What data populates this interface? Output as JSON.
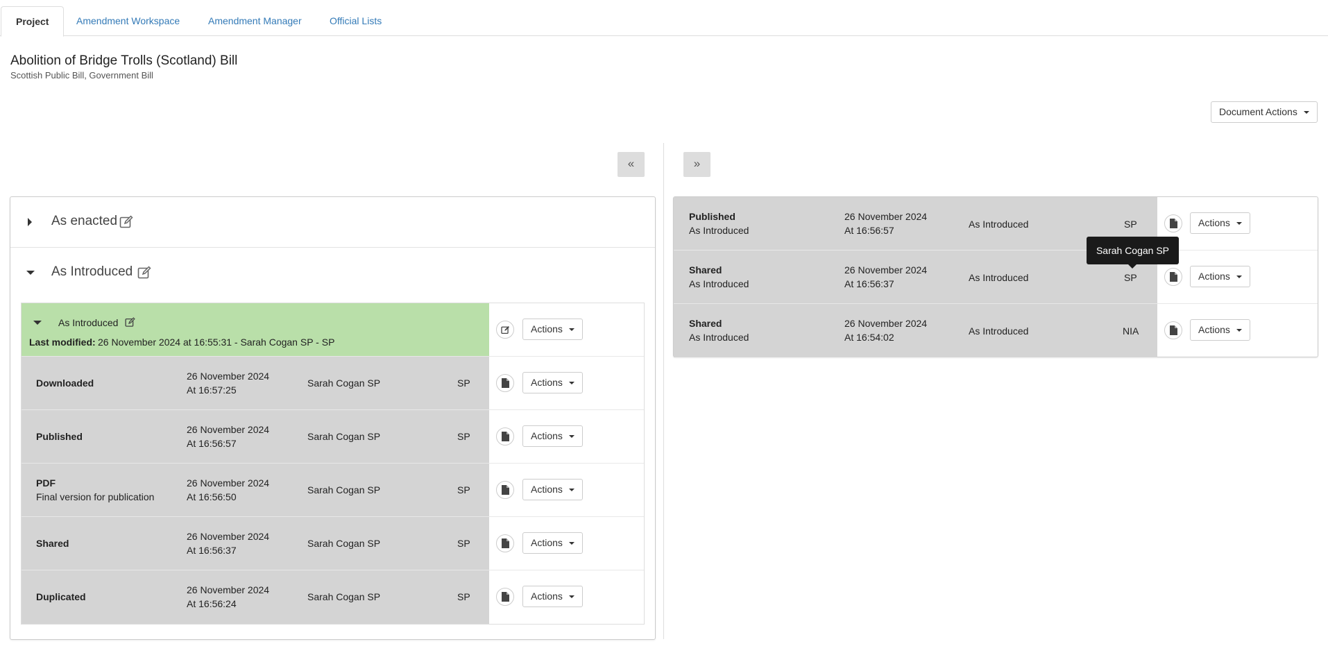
{
  "tabs": [
    {
      "label": "Project"
    },
    {
      "label": "Amendment Workspace"
    },
    {
      "label": "Amendment Manager"
    },
    {
      "label": "Official Lists"
    }
  ],
  "project": {
    "title": "Abolition of Bridge Trolls (Scotland) Bill",
    "subtitle": "Scottish Public Bill, Government Bill"
  },
  "document_actions_label": "Document Actions",
  "collapse_left_label": "«",
  "expand_right_label": "»",
  "left": {
    "sections": [
      {
        "label": "As enacted",
        "expanded": false
      },
      {
        "label": "As Introduced",
        "expanded": true
      }
    ],
    "version": {
      "label": "As Introduced",
      "last_modified_label": "Last modified:",
      "last_modified_value": "26 November 2024 at 16:55:31 - Sarah Cogan SP - SP",
      "actions_label": "Actions"
    },
    "rows": [
      {
        "event": "Downloaded",
        "note": "",
        "date": "26 November 2024",
        "time": "At 16:57:25",
        "user": "Sarah Cogan SP",
        "org": "SP",
        "actions_label": "Actions"
      },
      {
        "event": "Published",
        "note": "",
        "date": "26 November 2024",
        "time": "At 16:56:57",
        "user": "Sarah Cogan SP",
        "org": "SP",
        "actions_label": "Actions"
      },
      {
        "event": "PDF",
        "note": "Final version for publication",
        "date": "26 November 2024",
        "time": "At 16:56:50",
        "user": "Sarah Cogan SP",
        "org": "SP",
        "actions_label": "Actions"
      },
      {
        "event": "Shared",
        "note": "",
        "date": "26 November 2024",
        "time": "At 16:56:37",
        "user": "Sarah Cogan SP",
        "org": "SP",
        "actions_label": "Actions"
      },
      {
        "event": "Duplicated",
        "note": "",
        "date": "26 November 2024",
        "time": "At 16:56:24",
        "user": "Sarah Cogan SP",
        "org": "SP",
        "actions_label": "Actions"
      }
    ]
  },
  "right": {
    "rows": [
      {
        "event": "Published",
        "sub": "As Introduced",
        "date": "26 November 2024",
        "time": "At 16:56:57",
        "version": "As Introduced",
        "org": "SP",
        "actions_label": "Actions"
      },
      {
        "event": "Shared",
        "sub": "As Introduced",
        "date": "26 November 2024",
        "time": "At 16:56:37",
        "version": "As Introduced",
        "org": "SP",
        "actions_label": "Actions"
      },
      {
        "event": "Shared",
        "sub": "As Introduced",
        "date": "26 November 2024",
        "time": "At 16:54:02",
        "version": "As Introduced",
        "org": "NIA",
        "actions_label": "Actions"
      }
    ]
  },
  "tooltip": {
    "text": "Sarah Cogan SP"
  },
  "icons": {
    "edit": "edit-pencil-icon",
    "file": "file-icon",
    "caret": "caret-down-icon"
  },
  "colors": {
    "link": "#337ab7",
    "row_grey": "#d4d4d4",
    "row_green": "#b9dfa9",
    "tooltip_bg": "#1a1a1a"
  }
}
